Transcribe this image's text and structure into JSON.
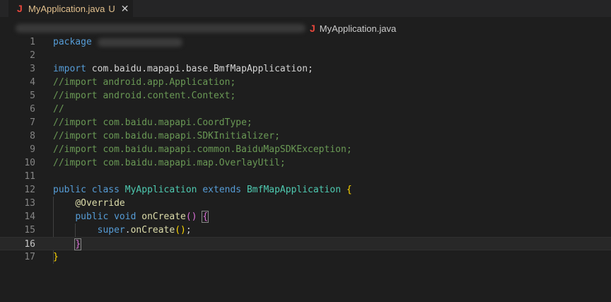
{
  "tab": {
    "icon": "java-file-icon",
    "icon_glyph": "J",
    "name": "MyApplication.java",
    "status": "U",
    "close": "✕"
  },
  "breadcrumb": {
    "icon_glyph": "J",
    "file": "MyApplication.java"
  },
  "lines": [
    {
      "n": "1",
      "tokens": [
        [
          "kw",
          "package"
        ]
      ],
      "blur": true
    },
    {
      "n": "2",
      "tokens": []
    },
    {
      "n": "3",
      "tokens": [
        [
          "kw",
          "import"
        ],
        [
          "txt",
          " com.baidu.mapapi.base.BmfMapApplication;"
        ]
      ]
    },
    {
      "n": "4",
      "tokens": [
        [
          "cm",
          "//import android.app.Application;"
        ]
      ]
    },
    {
      "n": "5",
      "tokens": [
        [
          "cm",
          "//import android.content.Context;"
        ]
      ]
    },
    {
      "n": "6",
      "tokens": [
        [
          "cm",
          "//"
        ]
      ]
    },
    {
      "n": "7",
      "tokens": [
        [
          "cm",
          "//import com.baidu.mapapi.CoordType;"
        ]
      ]
    },
    {
      "n": "8",
      "tokens": [
        [
          "cm",
          "//import com.baidu.mapapi.SDKInitializer;"
        ]
      ]
    },
    {
      "n": "9",
      "tokens": [
        [
          "cm",
          "//import com.baidu.mapapi.common.BaiduMapSDKException;"
        ]
      ]
    },
    {
      "n": "10",
      "tokens": [
        [
          "cm",
          "//import com.baidu.mapapi.map.OverlayUtil;"
        ]
      ]
    },
    {
      "n": "11",
      "tokens": []
    },
    {
      "n": "12",
      "tokens": [
        [
          "kw",
          "public"
        ],
        [
          "txt",
          " "
        ],
        [
          "kw",
          "class"
        ],
        [
          "txt",
          " "
        ],
        [
          "cls",
          "MyApplication"
        ],
        [
          "txt",
          " "
        ],
        [
          "kw",
          "extends"
        ],
        [
          "txt",
          " "
        ],
        [
          "cls",
          "BmfMapApplication"
        ],
        [
          "txt",
          " "
        ],
        [
          "br1",
          "{"
        ]
      ]
    },
    {
      "n": "13",
      "tokens": [
        [
          "txt",
          "    "
        ],
        [
          "ann",
          "@Override"
        ]
      ]
    },
    {
      "n": "14",
      "tokens": [
        [
          "txt",
          "    "
        ],
        [
          "kw",
          "public"
        ],
        [
          "txt",
          " "
        ],
        [
          "kw",
          "void"
        ],
        [
          "txt",
          " "
        ],
        [
          "fn",
          "onCreate"
        ],
        [
          "br2",
          "()"
        ],
        [
          "txt",
          " "
        ],
        [
          "br2",
          "{"
        ]
      ]
    },
    {
      "n": "15",
      "tokens": [
        [
          "txt",
          "        "
        ],
        [
          "kw",
          "super"
        ],
        [
          "txt",
          "."
        ],
        [
          "fn",
          "onCreate"
        ],
        [
          "br1",
          "()"
        ],
        [
          "txt",
          ";"
        ]
      ]
    },
    {
      "n": "16",
      "tokens": [
        [
          "txt",
          "    "
        ],
        [
          "br2",
          "}"
        ]
      ],
      "current": true
    },
    {
      "n": "17",
      "tokens": [
        [
          "br1",
          "}"
        ]
      ]
    }
  ]
}
